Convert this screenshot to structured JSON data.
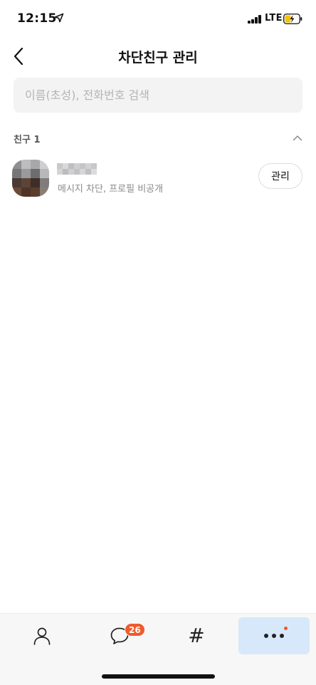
{
  "status_bar": {
    "time": "12:15",
    "network": "LTE"
  },
  "header": {
    "title": "차단친구 관리"
  },
  "search": {
    "placeholder": "이름(초성), 전화번호 검색",
    "value": ""
  },
  "section": {
    "label": "친구 1",
    "expanded": true
  },
  "friends": [
    {
      "status": "메시지 차단, 프로필 비공개",
      "action_label": "관리"
    }
  ],
  "tab_bar": {
    "tabs": [
      {
        "icon": "person-icon"
      },
      {
        "icon": "chat-bubble-icon",
        "badge": "26"
      },
      {
        "icon": "hashtag-icon",
        "glyph": "#"
      },
      {
        "icon": "more-icon",
        "active": true,
        "has_notification": true
      }
    ]
  },
  "colors": {
    "accent_badge": "#ee5b2d",
    "active_tab_bg": "#d8e8fb",
    "search_bg": "#f3f3f3"
  }
}
